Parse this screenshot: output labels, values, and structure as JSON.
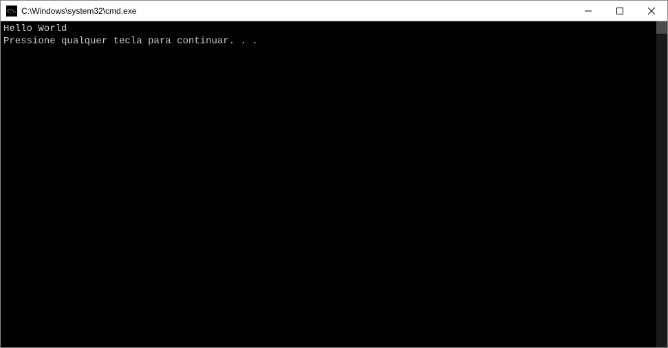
{
  "window": {
    "title": "C:\\Windows\\system32\\cmd.exe",
    "icon_label": "C:\\."
  },
  "titlebar_controls": {
    "minimize": "minimize",
    "maximize": "maximize",
    "close": "close"
  },
  "terminal": {
    "lines": [
      "Hello World",
      "Pressione qualquer tecla para continuar. . ."
    ]
  }
}
